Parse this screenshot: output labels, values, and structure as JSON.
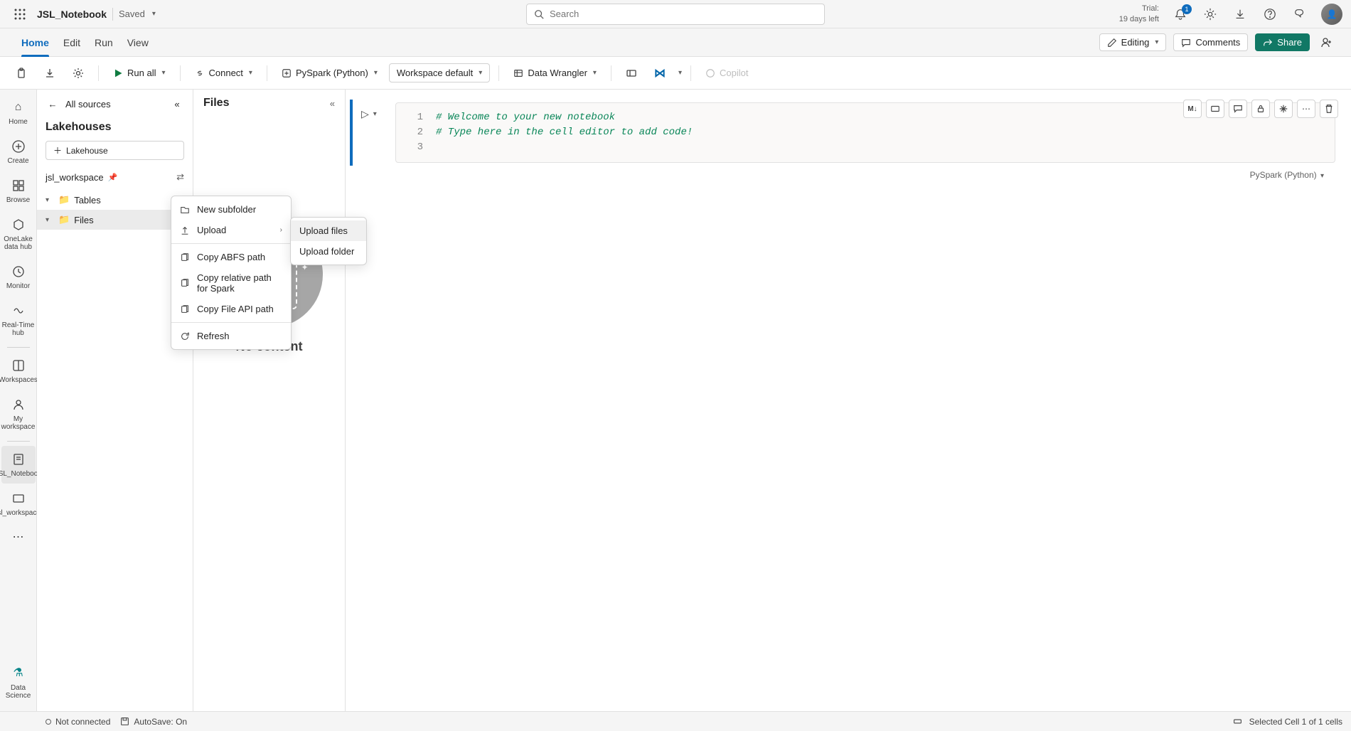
{
  "header": {
    "notebook_title": "JSL_Notebook",
    "saved_label": "Saved",
    "search_placeholder": "Search",
    "trial_label": "Trial:",
    "trial_days": "19 days left",
    "notif_count": "1"
  },
  "ribbon": {
    "tabs": [
      "Home",
      "Edit",
      "Run",
      "View"
    ],
    "editing": "Editing",
    "comments": "Comments",
    "share": "Share"
  },
  "toolbar": {
    "run_all": "Run all",
    "connect": "Connect",
    "kernel": "PySpark (Python)",
    "workspace": "Workspace default",
    "data_wrangler": "Data Wrangler",
    "copilot": "Copilot"
  },
  "left_rail": {
    "items": [
      {
        "label": "Home",
        "icon": "home"
      },
      {
        "label": "Create",
        "icon": "plus"
      },
      {
        "label": "Browse",
        "icon": "grid"
      },
      {
        "label": "OneLake data hub",
        "icon": "hex"
      },
      {
        "label": "Monitor",
        "icon": "monitor"
      },
      {
        "label": "Real-Time hub",
        "icon": "realtime"
      },
      {
        "label": "Workspaces",
        "icon": "workspaces"
      },
      {
        "label": "My workspace",
        "icon": "myws"
      },
      {
        "label": "JSL_Notebook",
        "icon": "nb"
      },
      {
        "label": "jsl_workspace",
        "icon": "ws"
      }
    ],
    "bottom_label": "Data Science"
  },
  "explorer": {
    "all_sources": "All sources",
    "title": "Lakehouses",
    "add_lakehouse": "Lakehouse",
    "workspace_name": "jsl_workspace",
    "tree": {
      "tables": "Tables",
      "files": "Files"
    }
  },
  "files_panel": {
    "title": "Files",
    "no_content": "No content"
  },
  "context_menu": {
    "new_subfolder": "New subfolder",
    "upload": "Upload",
    "copy_abfs": "Copy ABFS path",
    "copy_rel_spark": "Copy relative path for Spark",
    "copy_file_api": "Copy File API path",
    "refresh": "Refresh",
    "upload_files": "Upload files",
    "upload_folder": "Upload folder"
  },
  "notebook": {
    "code_lines": [
      "# Welcome to your new notebook",
      "# Type here in the cell editor to add code!",
      ""
    ],
    "lang_label": "PySpark (Python)"
  },
  "status": {
    "connection": "Not connected",
    "autosave": "AutoSave: On",
    "selection": "Selected Cell 1 of 1 cells"
  }
}
